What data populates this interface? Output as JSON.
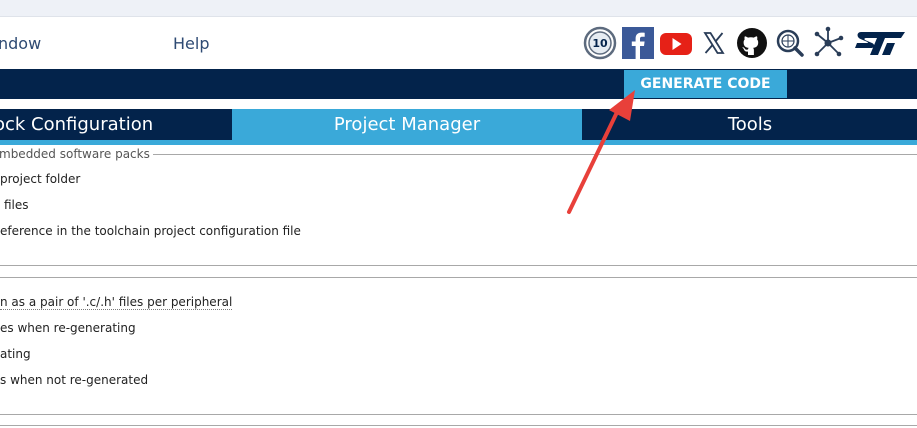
{
  "menu": {
    "window": "ndow",
    "help": "Help"
  },
  "toolbar": {
    "icons": [
      "anniversary-10-badge-icon",
      "facebook-icon",
      "youtube-icon",
      "x-twitter-icon",
      "github-icon",
      "community-icon",
      "network-icon",
      "st-logo-icon"
    ],
    "badge_text": "10",
    "generate_code": "GENERATE CODE"
  },
  "tabs": [
    {
      "label": "ock Configuration",
      "active": false
    },
    {
      "label": "Project Manager",
      "active": true
    },
    {
      "label": "Tools",
      "active": false
    }
  ],
  "group1": {
    "legend": "mbedded software packs",
    "rows": [
      "project folder",
      "files",
      "eference in the toolchain project configuration file"
    ]
  },
  "group2": {
    "rows": [
      "n as a pair of '.c/.h' files per peripheral",
      "es when re-generating",
      "ating",
      "s when not re-generated"
    ]
  },
  "colors": {
    "navy": "#03234b",
    "accent": "#3aa9d9",
    "annotation_arrow": "#e8403a",
    "facebook": "#3b5998",
    "youtube": "#e62117"
  }
}
